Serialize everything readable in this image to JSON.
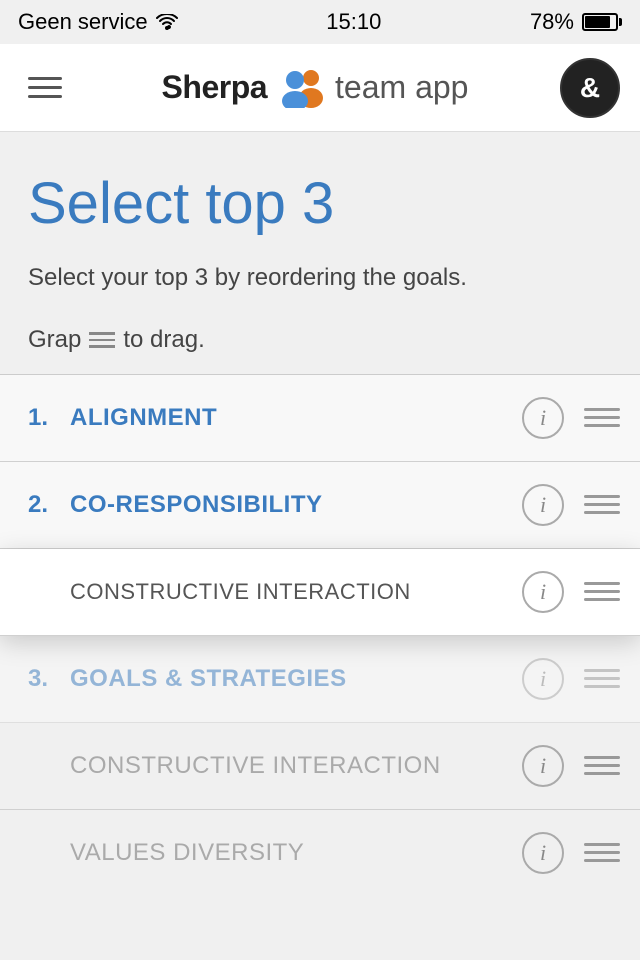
{
  "statusBar": {
    "carrier": "Geen service",
    "time": "15:10",
    "battery": "78%"
  },
  "navBar": {
    "logoText": "Sherpa",
    "logoTeam": "team app",
    "profileSymbol": "&"
  },
  "page": {
    "title": "Select top 3",
    "descriptionLine1": "Select your top 3 by reordering the goals.",
    "descriptionLine2": "Grap",
    "descriptionLine3": "to drag."
  },
  "goals": [
    {
      "number": "1.",
      "label": "ALIGNMENT",
      "active": true,
      "dragging": false,
      "overlay": false
    },
    {
      "number": "2.",
      "label": "CO-RESPONSIBILITY",
      "active": true,
      "dragging": false,
      "overlay": false
    },
    {
      "number": "",
      "label": "CONSTRUCTIVE INTERACTION",
      "active": false,
      "dragging": true,
      "overlay": true
    },
    {
      "number": "3.",
      "label": "GOALS & STRATEGIES",
      "active": true,
      "dragging": false,
      "overlay": false
    },
    {
      "number": "",
      "label": "CONSTRUCTIVE INTERACTION",
      "active": false,
      "dragging": false,
      "overlay": false
    },
    {
      "number": "",
      "label": "VALUES DIVERSITY",
      "active": false,
      "dragging": false,
      "overlay": false
    }
  ]
}
